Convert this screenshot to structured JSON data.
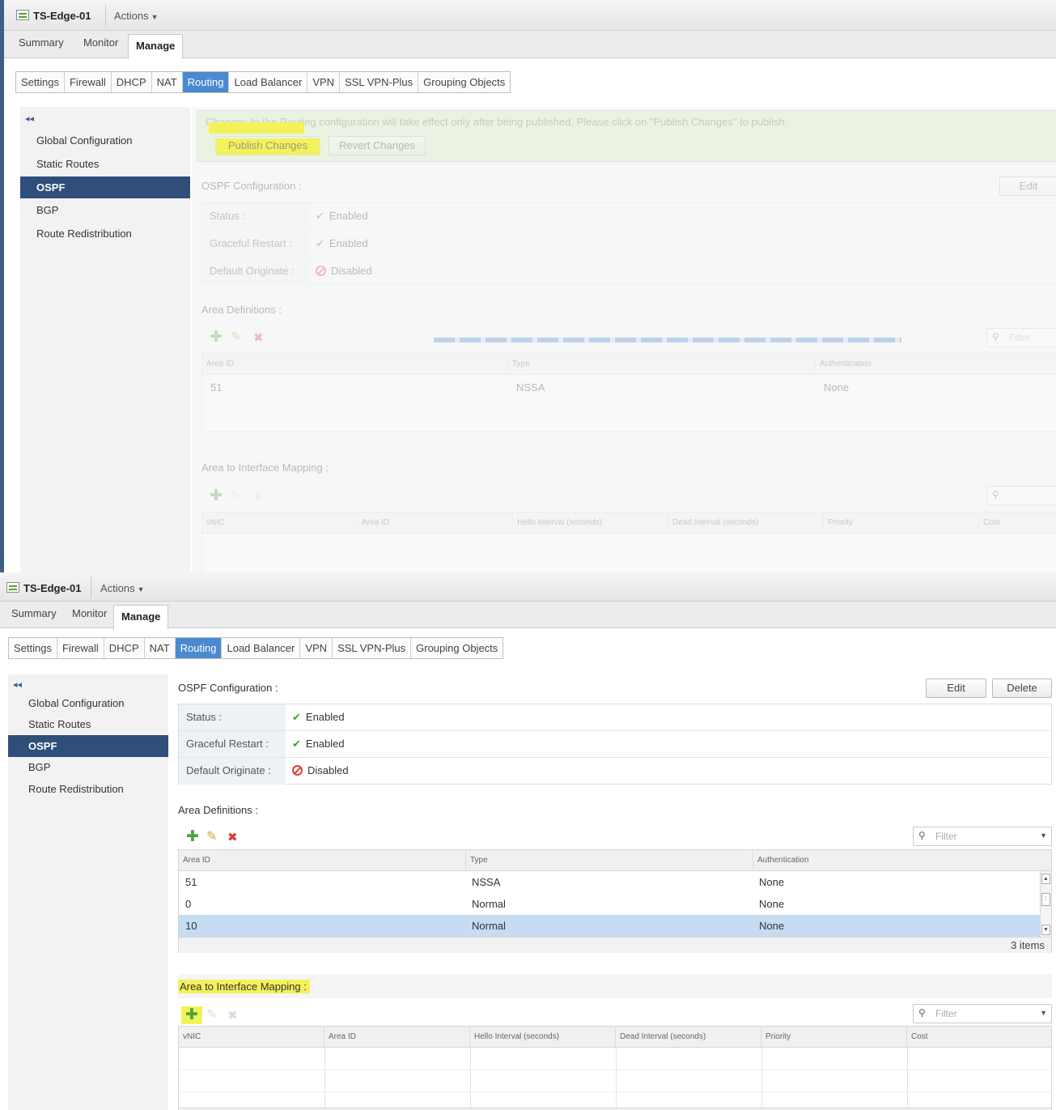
{
  "object": {
    "title": "TS-Edge-01",
    "actions_label": "Actions"
  },
  "main_tabs": [
    "Summary",
    "Monitor",
    "Manage"
  ],
  "sub_tabs": [
    "Settings",
    "Firewall",
    "DHCP",
    "NAT",
    "Routing",
    "Load Balancer",
    "VPN",
    "SSL VPN-Plus",
    "Grouping Objects"
  ],
  "nav": {
    "collapse": "◂◂",
    "items": [
      "Global Configuration",
      "Static Routes",
      "OSPF",
      "BGP",
      "Route Redistribution"
    ],
    "active": "OSPF"
  },
  "publish": {
    "message": "Changes to the Routing configuration will take effect only after being published. Please click on \"Publish Changes\" to publish.",
    "publish_label": "Publish Changes",
    "revert_label": "Revert Changes"
  },
  "ospf": {
    "title": "OSPF Configuration :",
    "edit_label": "Edit",
    "delete_label": "Delete",
    "props": [
      {
        "label": "Status :",
        "value": "Enabled",
        "state": "enabled"
      },
      {
        "label": "Graceful Restart :",
        "value": "Enabled",
        "state": "enabled"
      },
      {
        "label": "Default Originate :",
        "value": "Disabled",
        "state": "disabled"
      }
    ]
  },
  "area_definitions": {
    "title": "Area Definitions :",
    "filter_placeholder": "Filter",
    "columns": [
      "Area ID",
      "Type",
      "Authentication"
    ],
    "rows": [
      {
        "area_id": "51",
        "type": "NSSA",
        "auth": "None"
      },
      {
        "area_id": "0",
        "type": "Normal",
        "auth": "None"
      },
      {
        "area_id": "10",
        "type": "Normal",
        "auth": "None"
      }
    ],
    "selected_row": 2,
    "count_label": "3 items"
  },
  "area_interface_mapping": {
    "title": "Area to Interface Mapping :",
    "filter_placeholder": "Filter",
    "columns": [
      "vNIC",
      "Area ID",
      "Hello Interval (seconds)",
      "Dead Interval (seconds)",
      "Priority",
      "Cost"
    ]
  },
  "icons": {
    "add": "plus-icon",
    "edit": "pencil-icon",
    "delete": "x-icon",
    "search": "magnifier-icon",
    "enabled": "checkmark-icon",
    "disabled": "prohibited-icon"
  },
  "colors": {
    "nav_active": "#2f4f7a",
    "tab_active": "#4a8ad0",
    "enabled": "#3fa33f",
    "disabled": "#d9463c",
    "highlight": "#f3f25a",
    "selected_row": "#c5dcf3"
  }
}
